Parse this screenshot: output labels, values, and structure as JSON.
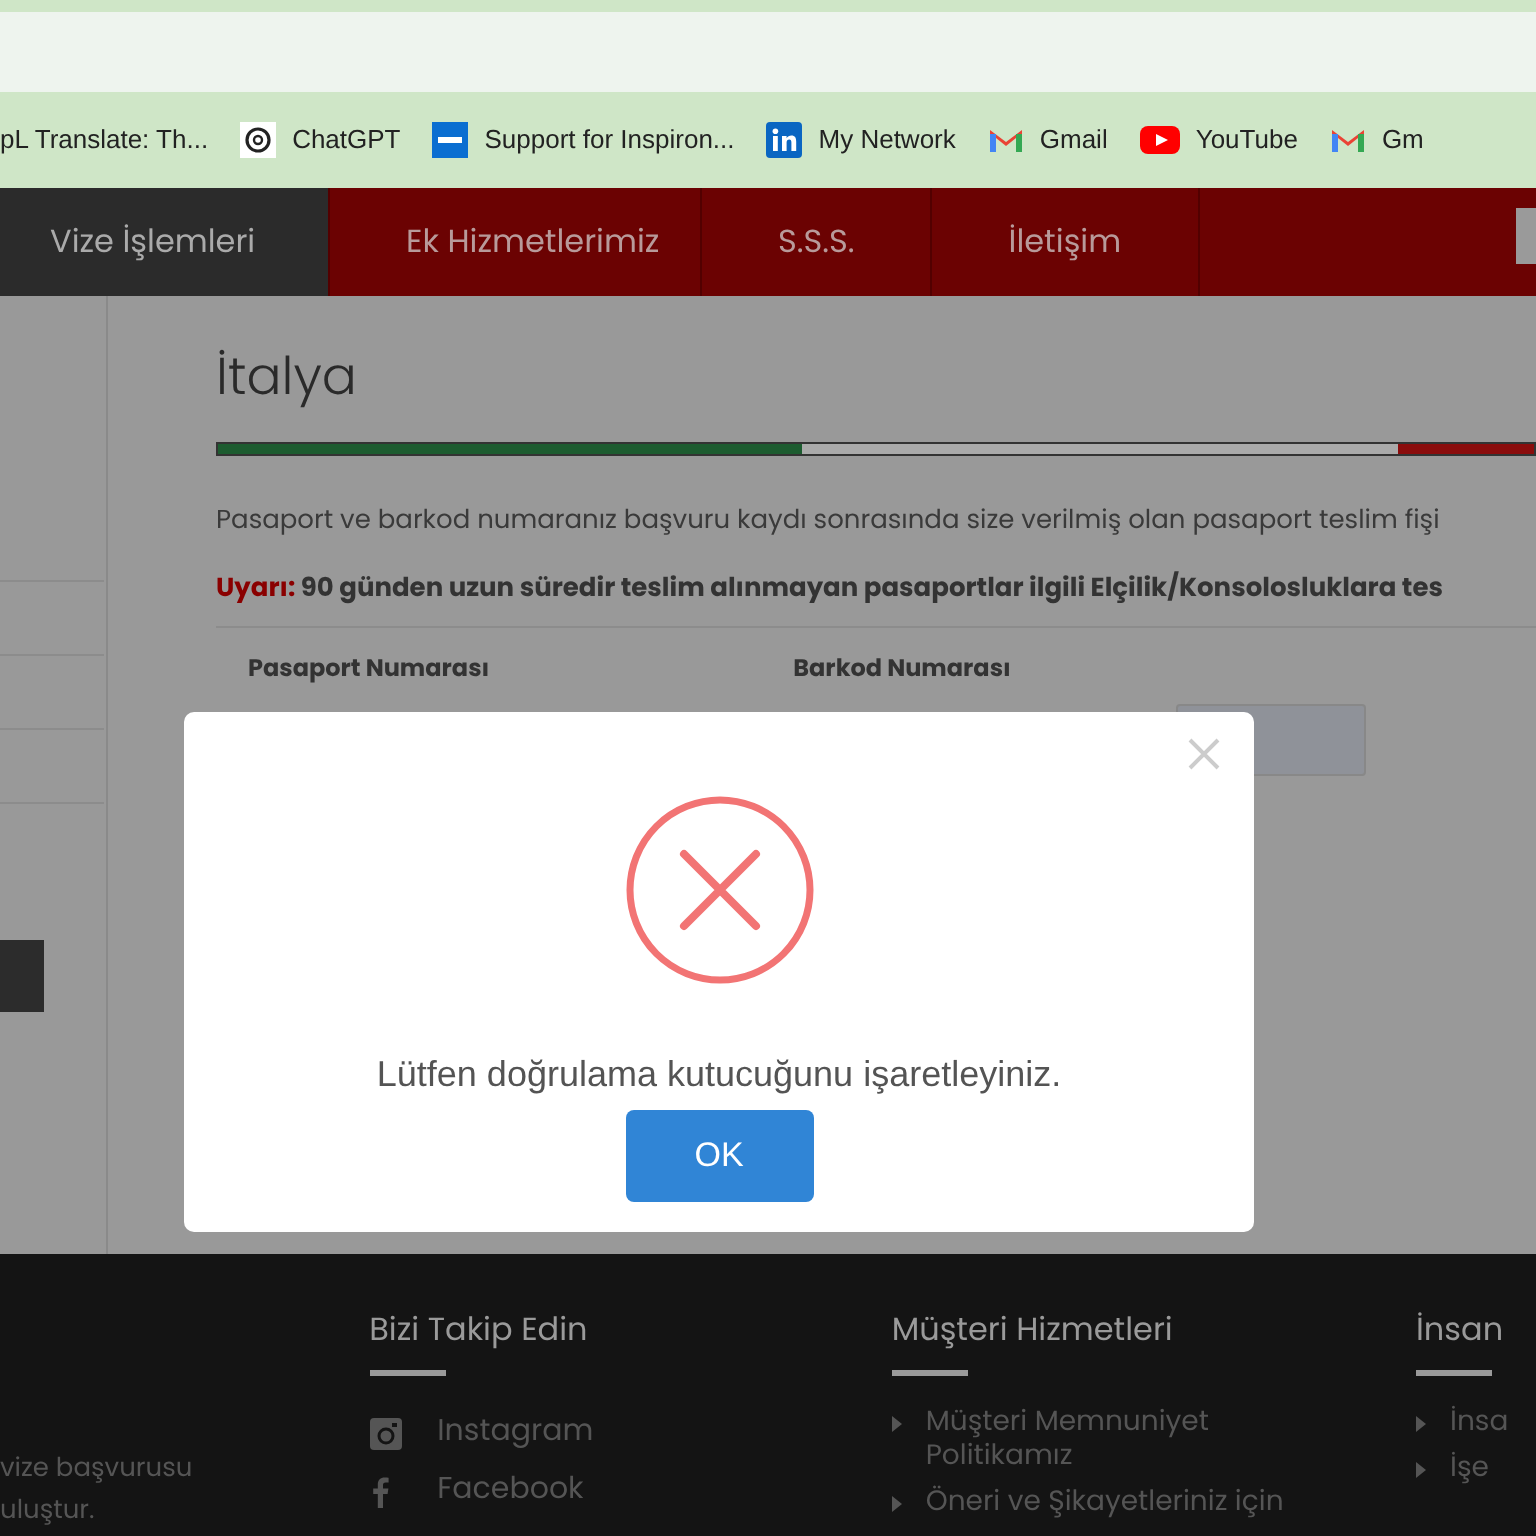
{
  "bookmarks": [
    {
      "label": "pL Translate: Th..."
    },
    {
      "label": "ChatGPT"
    },
    {
      "label": "Support for Inspiron..."
    },
    {
      "label": "My Network"
    },
    {
      "label": "Gmail"
    },
    {
      "label": "YouTube"
    },
    {
      "label": "Gm"
    }
  ],
  "nav": {
    "tabs": [
      {
        "label": "Vize İşlemleri",
        "selected": true
      },
      {
        "label": "Ek Hizmetlerimiz",
        "selected": false
      },
      {
        "label": "S.S.S.",
        "selected": false
      },
      {
        "label": "İletişim",
        "selected": false
      }
    ]
  },
  "content": {
    "title": "İtalya",
    "intro": "Pasaport ve barkod numaranız başvuru kaydı sonrasında size verilmiş olan pasaport teslim fişi",
    "warning_label": "Uyarı:",
    "warning": "90 günden uzun süredir teslim alınmayan pasaportlar ilgili Elçilik/Konsolosluklara tes",
    "fields": [
      {
        "label": "Pasaport Numarası"
      },
      {
        "label": "Barkod Numarası"
      }
    ]
  },
  "dialog": {
    "message": "Lütfen doğrulama kutucuğunu işaretleyiniz.",
    "button": "OK"
  },
  "footer": {
    "left_text": [
      "vize başvurusu",
      "uluştur."
    ],
    "columns": [
      {
        "title": "Bizi Takip Edin",
        "kind": "social",
        "items": [
          {
            "label": "Instagram"
          },
          {
            "label": "Facebook"
          }
        ]
      },
      {
        "title": "Müşteri Hizmetleri",
        "kind": "links",
        "items": [
          {
            "label": "Müşteri Memnuniyet Politikamız"
          },
          {
            "label": "Öneri ve Şikayetleriniz için"
          }
        ]
      },
      {
        "title": "İnsan",
        "kind": "links",
        "items": [
          {
            "label": "İnsa"
          },
          {
            "label": "İşe"
          }
        ]
      }
    ]
  }
}
